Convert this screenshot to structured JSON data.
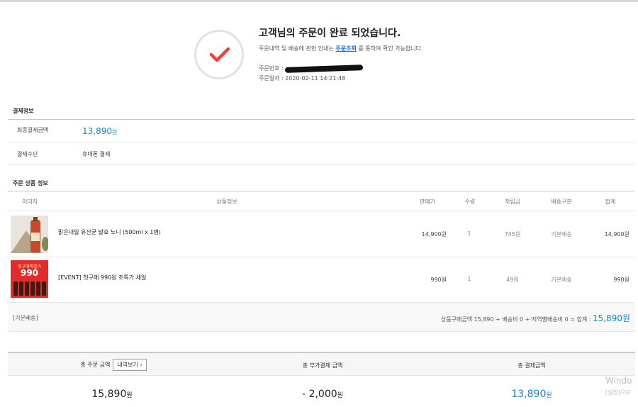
{
  "completion": {
    "title": "고객님의 주문이 완료 되었습니다.",
    "desc_before": "주문내역 및 배송에 관한 안내는 ",
    "desc_link": "주문조회",
    "desc_after": " 를 통하여 확인 가능합니다.",
    "order_no_label": "주문번호 :",
    "order_date": "주문일자 : 2020-02-11 14:21:48"
  },
  "payment": {
    "section_title": "결제정보",
    "total_label": "최종결제금액",
    "total_value": "13,890",
    "total_unit": "원",
    "method_label": "결제수단",
    "method_value": "휴대폰 결제"
  },
  "products": {
    "section_title": "주문 상품 정보",
    "headers": [
      "이미지",
      "상품정보",
      "판매가",
      "수량",
      "적립금",
      "배송구분",
      "합계"
    ],
    "rows": [
      {
        "name": "맑은내일 유산균 발효 노니 (500ml x 1병)",
        "price": "14,900원",
        "qty": "1",
        "points": "745원",
        "ship": "기본배송",
        "total": "14,900원"
      },
      {
        "name": "[EVENT] 첫구매 990원 초특가 세일",
        "price": "990원",
        "qty": "1",
        "points": "49원",
        "ship": "기본배송",
        "total": "990원",
        "thumb_top": "첫구매특별가",
        "thumb_big": "990"
      }
    ],
    "ship_type": "[기본배송]",
    "ship_summary": "상품구매금액 15,890 + 배송비 0 + 지역별배송비 0 = 합계 : ",
    "ship_total": "15,890원"
  },
  "summary": {
    "order_total_label": "총 주문 금액",
    "detail_button": "내역보기",
    "extra_label": "총 부가결제 금액",
    "pay_label": "총 결제금액",
    "order_total": "15,890",
    "extra_total": "- 2,000",
    "pay_total": "13,890",
    "unit": "원"
  },
  "watermark": {
    "line1": "Windo",
    "line2": "[설정]으로"
  },
  "colors": {
    "accent": "#1a82c4",
    "check": "#e8453c"
  }
}
